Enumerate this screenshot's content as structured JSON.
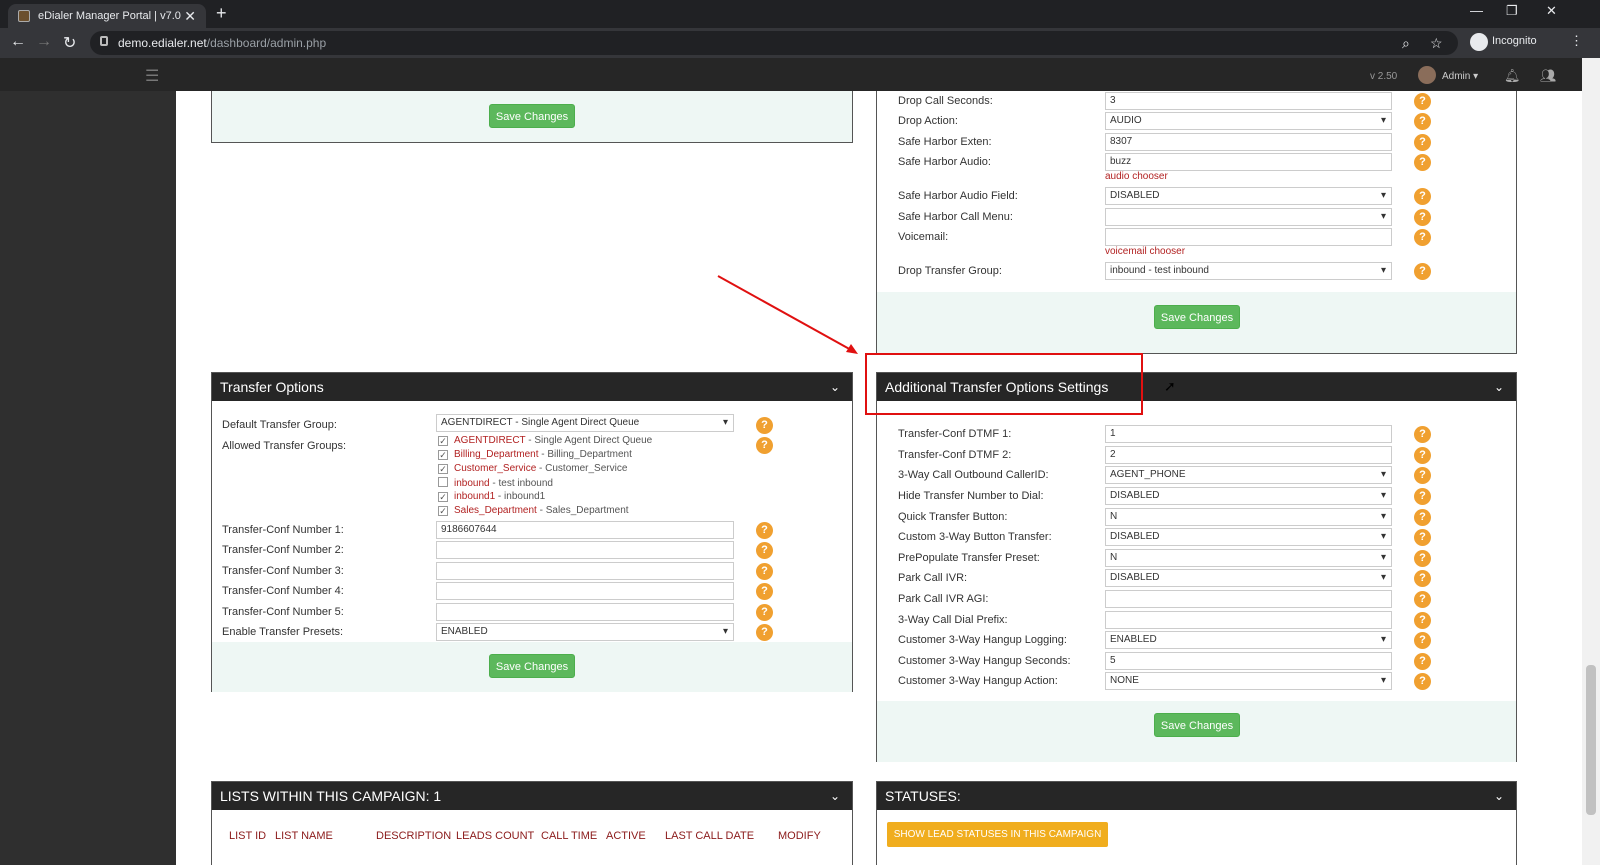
{
  "browser": {
    "tab_title": "eDialer Manager Portal | v7.0",
    "tab_close": "✕",
    "new_tab": "+",
    "url_host": "demo.edialer.net",
    "url_path": "/dashboard/admin.php",
    "incognito_label": "Incognito"
  },
  "header": {
    "version": "v 2.50",
    "user": "Admin"
  },
  "top_left_panel": {
    "save_label": "Save Changes"
  },
  "drop_panel": {
    "fields": [
      {
        "label": "Drop Call Seconds:",
        "value": "3",
        "type": "input"
      },
      {
        "label": "Drop Action:",
        "value": "AUDIO",
        "type": "select"
      },
      {
        "label": "Safe Harbor Exten:",
        "value": "8307",
        "type": "input"
      },
      {
        "label": "Safe Harbor Audio:",
        "value": "buzz",
        "type": "input"
      },
      {
        "label": "Safe Harbor Audio Field:",
        "value": "DISABLED",
        "type": "select"
      },
      {
        "label": "Safe Harbor Call Menu:",
        "value": "",
        "type": "select"
      },
      {
        "label": "Voicemail:",
        "value": "",
        "type": "input"
      },
      {
        "label": "Drop Transfer Group:",
        "value": "inbound - test inbound",
        "type": "select"
      }
    ],
    "audio_chooser": "audio chooser",
    "voicemail_chooser": "voicemail chooser",
    "save_label": "Save Changes"
  },
  "transfer_options": {
    "title": "Transfer Options",
    "default_group_label": "Default Transfer Group:",
    "default_group_value": "AGENTDIRECT - Single Agent Direct Queue",
    "allowed_groups_label": "Allowed Transfer Groups:",
    "groups": [
      {
        "code": "AGENTDIRECT",
        "name": " - Single Agent Direct Queue",
        "checked": true
      },
      {
        "code": "Billing_Department",
        "name": " - Billing_Department",
        "checked": true
      },
      {
        "code": "Customer_Service",
        "name": " - Customer_Service",
        "checked": true
      },
      {
        "code": "inbound",
        "name": " - test inbound",
        "checked": false
      },
      {
        "code": "inbound1",
        "name": " - inbound1",
        "checked": true
      },
      {
        "code": "Sales_Department",
        "name": " - Sales_Department",
        "checked": true
      }
    ],
    "fields": [
      {
        "label": "Transfer-Conf Number 1:",
        "value": "9186607644",
        "type": "input"
      },
      {
        "label": "Transfer-Conf Number 2:",
        "value": "",
        "type": "input"
      },
      {
        "label": "Transfer-Conf Number 3:",
        "value": "",
        "type": "input"
      },
      {
        "label": "Transfer-Conf Number 4:",
        "value": "",
        "type": "input"
      },
      {
        "label": "Transfer-Conf Number 5:",
        "value": "",
        "type": "input"
      },
      {
        "label": "Enable Transfer Presets:",
        "value": "ENABLED",
        "type": "select"
      }
    ],
    "save_label": "Save Changes"
  },
  "additional_transfer": {
    "title": "Additional Transfer Options Settings",
    "fields": [
      {
        "label": "Transfer-Conf DTMF 1:",
        "value": "1",
        "type": "input"
      },
      {
        "label": "Transfer-Conf DTMF 2:",
        "value": "2",
        "type": "input"
      },
      {
        "label": "3-Way Call Outbound CallerID:",
        "value": "AGENT_PHONE",
        "type": "select"
      },
      {
        "label": "Hide Transfer Number to Dial:",
        "value": "DISABLED",
        "type": "select"
      },
      {
        "label": "Quick Transfer Button:",
        "value": "N",
        "type": "select"
      },
      {
        "label": "Custom 3-Way Button Transfer:",
        "value": "DISABLED",
        "type": "select"
      },
      {
        "label": "PrePopulate Transfer Preset:",
        "value": "N",
        "type": "select"
      },
      {
        "label": "Park Call IVR:",
        "value": "DISABLED",
        "type": "select"
      },
      {
        "label": "Park Call IVR AGI:",
        "value": "",
        "type": "input"
      },
      {
        "label": "3-Way Call Dial Prefix:",
        "value": "",
        "type": "input"
      },
      {
        "label": "Customer 3-Way Hangup Logging:",
        "value": "ENABLED",
        "type": "select"
      },
      {
        "label": "Customer 3-Way Hangup Seconds:",
        "value": "5",
        "type": "input"
      },
      {
        "label": "Customer 3-Way Hangup Action:",
        "value": "NONE",
        "type": "select"
      }
    ],
    "save_label": "Save Changes"
  },
  "lists_panel": {
    "title": "LISTS WITHIN THIS CAMPAIGN: 1",
    "columns": [
      "LIST ID",
      "LIST NAME",
      "DESCRIPTION",
      "LEADS COUNT",
      "CALL TIME",
      "ACTIVE",
      "LAST CALL DATE",
      "MODIFY"
    ]
  },
  "statuses_panel": {
    "title": "STATUSES:",
    "button_label": "SHOW LEAD STATUSES IN THIS CAMPAIGN"
  },
  "help_glyph": "?",
  "chevron_glyph": "⌄",
  "colors": {
    "panel_header": "#262626",
    "save_green": "#5cb85c",
    "help_orange": "#f0a030",
    "annotation_red": "#e01010",
    "status_button": "#f0ad1e"
  }
}
